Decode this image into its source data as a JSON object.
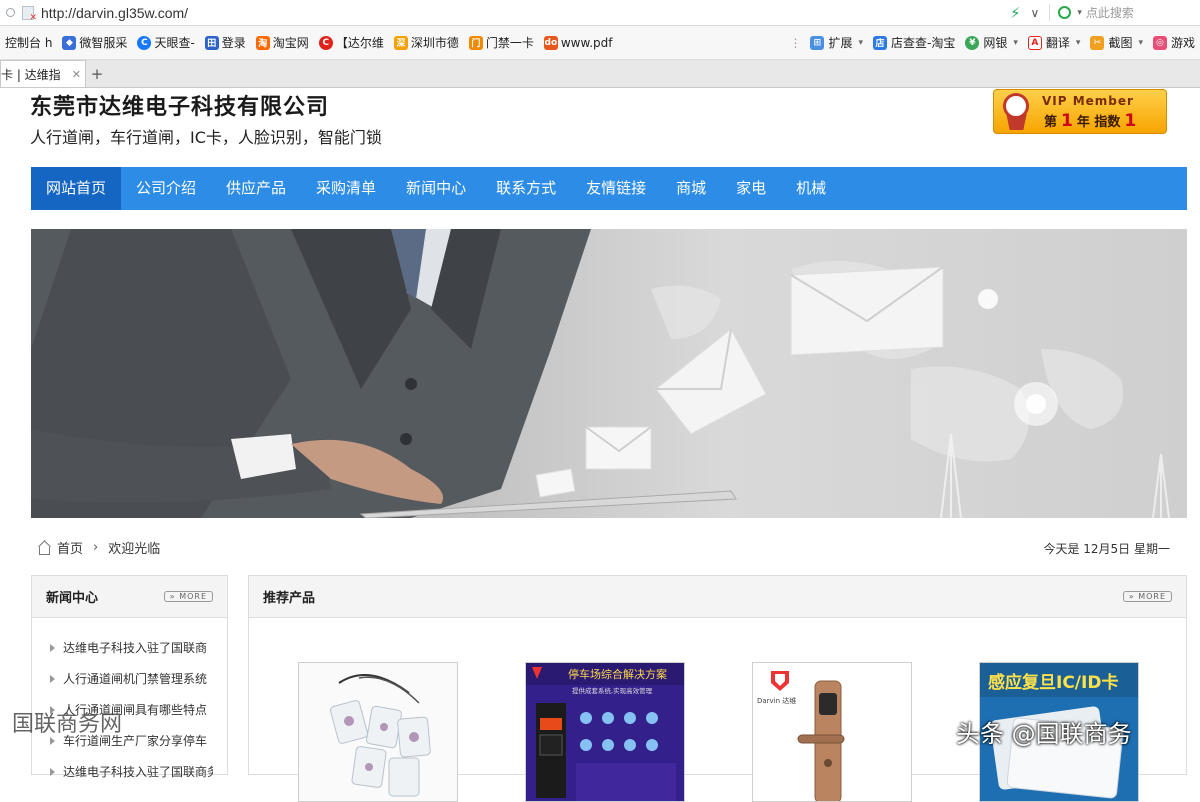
{
  "browser": {
    "url": "http://darvin.gl35w.com/",
    "search_placeholder": "点此搜索",
    "bookmarks": [
      {
        "label": "控制台 h",
        "color": "#888"
      },
      {
        "label": "微智服采",
        "color": "#3b6fd8"
      },
      {
        "label": "天眼查-",
        "color": "#1677ff"
      },
      {
        "label": "登录",
        "color": "#2f63c9"
      },
      {
        "label": "淘宝网",
        "color": "#ff6a00"
      },
      {
        "label": "【达尔维",
        "color": "#e0241b"
      },
      {
        "label": "深圳市德",
        "color": "#f2a100"
      },
      {
        "label": "门禁一卡",
        "color": "#f08a00"
      },
      {
        "label": "www.pdf",
        "color": "#e8581c"
      }
    ],
    "bookmarks_right": [
      {
        "label": "扩展"
      },
      {
        "label": "店查查-淘宝"
      },
      {
        "label": "网银"
      },
      {
        "label": "翻译"
      },
      {
        "label": "截图"
      },
      {
        "label": "游戏"
      }
    ],
    "tab_label": "卡 | 达维指",
    "tab_close": "✕",
    "new_tab": "+"
  },
  "header": {
    "company": "东莞市达维电子科技有限公司",
    "slogan": "人行道闸，车行道闸，IC卡，人脸识别，智能门锁",
    "vip": {
      "label": "VIP Member",
      "prefix": "第",
      "years": "1",
      "mid": "年  指数",
      "index": "1"
    }
  },
  "nav": [
    {
      "label": "网站首页",
      "active": true
    },
    {
      "label": "公司介绍",
      "active": false
    },
    {
      "label": "供应产品",
      "active": false
    },
    {
      "label": "采购清单",
      "active": false
    },
    {
      "label": "新闻中心",
      "active": false
    },
    {
      "label": "联系方式",
      "active": false
    },
    {
      "label": "友情链接",
      "active": false
    },
    {
      "label": "商城",
      "active": false
    },
    {
      "label": "家电",
      "active": false
    },
    {
      "label": "机械",
      "active": false
    }
  ],
  "breadcrumb": {
    "home": "首页",
    "sep": "›",
    "current": "欢迎光临"
  },
  "date": "今天是 12月5日 星期一",
  "news": {
    "title": "新闻中心",
    "more": "» MORE",
    "items": [
      "达维电子科技入驻了国联商",
      "人行通道闸机门禁管理系统",
      "人行通道闸闸具有哪些特点",
      "车行道闸生产厂家分享停车",
      "达维电子科技入驻了国联商务"
    ]
  },
  "recommend": {
    "title": "推荐产品",
    "more": "» MORE",
    "products": [
      {
        "name": "IC卡钥匙扣",
        "type": "keyfob"
      },
      {
        "name": "停车场综合解决方案",
        "banner": "停车场综合解决方案",
        "sub": "提供成套系统,实现高效管理",
        "type": "parking"
      },
      {
        "name": "智能门锁",
        "brand": "Darvin 达维",
        "type": "lock"
      },
      {
        "name": "感应复旦IC/ID卡",
        "banner": "感应复旦IC/ID卡",
        "type": "card"
      }
    ]
  },
  "watermarks": {
    "left": "国联商务网",
    "right": "头条 @国联商务"
  }
}
